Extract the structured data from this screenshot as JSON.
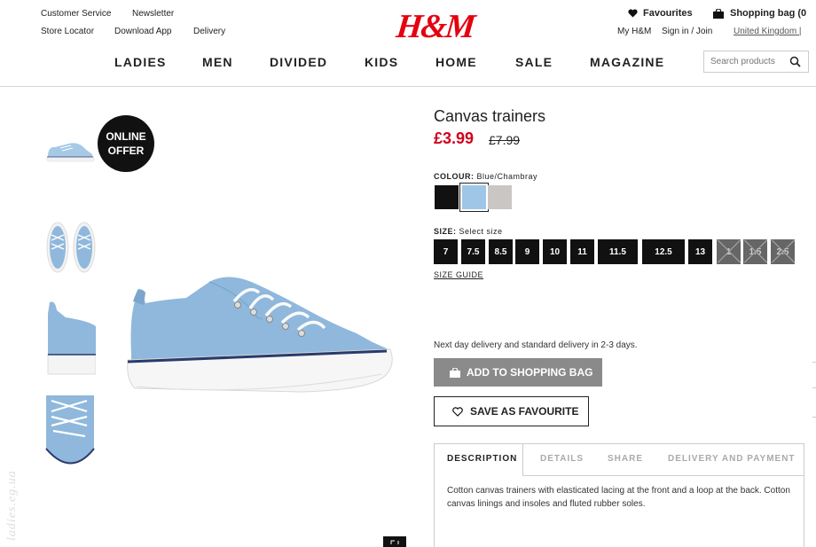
{
  "header": {
    "top_links": [
      "Customer Service",
      "Newsletter",
      "Store Locator",
      "Download App",
      "Delivery"
    ],
    "logo": "H&M",
    "favourites": "Favourites",
    "shopping_bag": "Shopping bag (0",
    "account_links": [
      "My H&M",
      "Sign in / Join",
      "United Kingdom | "
    ],
    "nav": [
      "LADIES",
      "MEN",
      "DIVIDED",
      "KIDS",
      "HOME",
      "SALE",
      "MAGAZINE"
    ],
    "search_placeholder": "Search products"
  },
  "gallery": {
    "badge_line1": "ONLINE",
    "badge_line2": "OFFER",
    "watermark": "ladies.eg.ua"
  },
  "product": {
    "title": "Canvas trainers",
    "price": "£3.99",
    "old_price": "£7.99",
    "colour_label": "COLOUR:",
    "colour_value": "Blue/Chambray",
    "colours": [
      {
        "name": "black",
        "hex": "#111111"
      },
      {
        "name": "blue-chambray",
        "hex": "#9fc6e6"
      },
      {
        "name": "grey",
        "hex": "#c9c6c4"
      }
    ],
    "size_label": "SIZE:",
    "size_value": "Select size",
    "sizes": [
      {
        "label": "7",
        "available": true
      },
      {
        "label": "7.5",
        "available": true
      },
      {
        "label": "8.5",
        "available": true
      },
      {
        "label": "9",
        "available": true
      },
      {
        "label": "10",
        "available": true
      },
      {
        "label": "11",
        "available": true
      },
      {
        "label": "11.5",
        "available": true
      },
      {
        "label": "12.5",
        "available": true
      },
      {
        "label": "13",
        "available": true
      },
      {
        "label": "1",
        "available": false
      },
      {
        "label": "1.5",
        "available": false
      },
      {
        "label": "2.5",
        "available": false
      }
    ],
    "size_guide": "SIZE GUIDE",
    "delivery": "Next day delivery and standard delivery in 2-3 days.",
    "add_to_bag": "ADD TO SHOPPING BAG",
    "save_favourite": "SAVE AS FAVOURITE",
    "tabs": [
      "DESCRIPTION",
      "DETAILS",
      "SHARE",
      "DELIVERY AND PAYMENT"
    ],
    "description": "Cotton canvas trainers with elasticated lacing at the front and a loop at the back. Cotton canvas linings and insoles and fluted rubber soles."
  },
  "colors": {
    "brand_red": "#e50010",
    "sale_red": "#d0021b",
    "shoe_blue": "#8fb8dc",
    "button_grey": "#8a8a8a"
  }
}
